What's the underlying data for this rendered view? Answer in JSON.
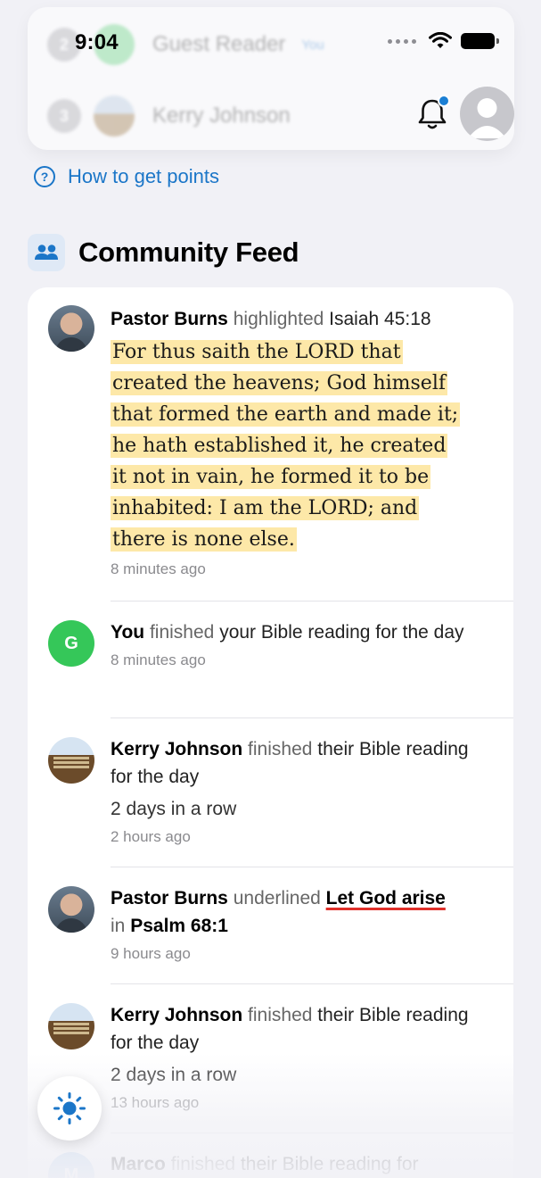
{
  "status_bar": {
    "time": "9:04"
  },
  "leaderboard": [
    {
      "rank": "2",
      "name": "Guest Reader",
      "tag": "You"
    },
    {
      "rank": "3",
      "name": "Kerry Johnson"
    }
  ],
  "header": {
    "notification_badge": true
  },
  "points_link": "How to get points",
  "feed": {
    "title": "Community Feed",
    "items": [
      {
        "user": "Pastor Burns",
        "action": "highlighted",
        "reference": "Isaiah 45:18",
        "verse_lines": [
          "For thus saith the LORD that",
          "created the heavens; God himself",
          "that formed the earth and made it;",
          "he hath established it, he created",
          "it not in vain, he formed it to be",
          "inhabited: I am the LORD; and",
          "there is none else."
        ],
        "time": "8 minutes ago"
      },
      {
        "avatar_letter": "G",
        "user": "You",
        "action": "finished",
        "rest": "your Bible reading for the day",
        "time": "8 minutes ago"
      },
      {
        "user": "Kerry Johnson",
        "action": "finished",
        "rest": "their Bible reading for the day",
        "streak": "2 days in a row",
        "time": "2 hours ago"
      },
      {
        "user": "Pastor Burns",
        "action": "underlined",
        "phrase": "Let God arise",
        "in_word": "in",
        "reference": "Psalm 68:1",
        "time": "9 hours ago"
      },
      {
        "user": "Kerry Johnson",
        "action": "finished",
        "rest": "their Bible reading for the day",
        "streak": "2 days in a row",
        "time": "13 hours ago"
      },
      {
        "avatar_letter": "M",
        "user": "Marco",
        "action": "finished",
        "rest": "their Bible reading for"
      }
    ]
  },
  "colors": {
    "accent": "#1b76c8",
    "highlight": "#fde8a8",
    "you_avatar": "#35c759",
    "underline": "#e0302a"
  },
  "icons": [
    "question-circle-icon",
    "people-icon",
    "bell-icon",
    "profile-icon",
    "sun-icon",
    "wifi-icon",
    "battery-icon"
  ]
}
